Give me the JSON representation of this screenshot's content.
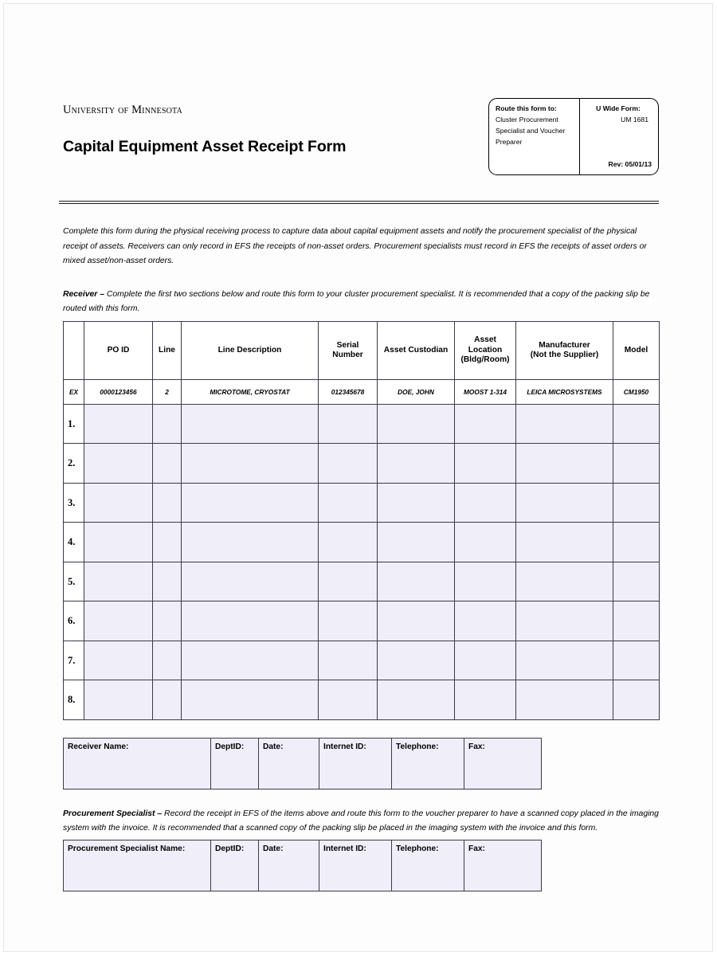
{
  "document": {
    "organization": "University of Minnesota",
    "title": "Capital Equipment Asset Receipt Form"
  },
  "routing_box": {
    "route_label": "Route this form to:",
    "route_target": "Cluster Procurement Specialist and Voucher Preparer",
    "form_type_label": "U Wide Form:",
    "form_number": "UM 1681",
    "revision": "Rev: 05/01/13"
  },
  "intro_paragraph": "Complete this form during the physical receiving process to capture data about capital equipment assets and notify the procurement specialist of the physical receipt of assets.  Receivers can only record in EFS the receipts of non-asset orders.  Procurement specialists must record in EFS the receipts of asset orders or mixed asset/non-asset orders.",
  "receiver_section": {
    "role_label": "Receiver –",
    "instructions": " Complete the first two sections below and route this form to your cluster procurement specialist.  It is recommended that a copy of the packing slip be routed with this form."
  },
  "asset_table": {
    "headers": {
      "rownum": "",
      "po_id": "PO ID",
      "line": "Line",
      "line_description": "Line Description",
      "serial_number_l1": "Serial",
      "serial_number_l2": "Number",
      "asset_custodian": "Asset Custodian",
      "asset_location_l1": "Asset",
      "asset_location_l2": "Location",
      "asset_location_l3": "(Bldg/Room)",
      "manufacturer_l1": "Manufacturer",
      "manufacturer_l2": "(Not the Supplier)",
      "model": "Model"
    },
    "example_row": {
      "label": "EX",
      "po_id": "0000123456",
      "line": "2",
      "line_description": "MICROTOME, CRYOSTAT",
      "serial_number": "012345678",
      "asset_custodian": "DOE, JOHN",
      "asset_location": "MOOST 1-314",
      "manufacturer": "LEICA MICROSYSTEMS",
      "model": "CM1950"
    },
    "row_labels": [
      "1.",
      "2.",
      "3.",
      "4.",
      "5.",
      "6.",
      "7.",
      "8."
    ]
  },
  "receiver_signature_row": {
    "name_label": "Receiver Name:",
    "deptid_label": "DeptID:",
    "date_label": "Date:",
    "internet_id_label": "Internet ID:",
    "telephone_label": "Telephone:",
    "fax_label": "Fax:"
  },
  "procurement_section": {
    "role_label": "Procurement Specialist –",
    "instructions": " Record the receipt in EFS of the items above and route this form to the voucher preparer to have a scanned copy placed in the imaging system with the invoice.  It is recommended that a scanned copy of the packing slip be placed in the imaging system with the invoice and this form."
  },
  "procurement_signature_row": {
    "name_label": "Procurement Specialist Name:",
    "deptid_label": "DeptID:",
    "date_label": "Date:",
    "internet_id_label": "Internet ID:",
    "telephone_label": "Telephone:",
    "fax_label": "Fax:"
  },
  "colors": {
    "field_fill": "#f0eef9",
    "border": "#3a3a4a",
    "text": "#000000"
  }
}
